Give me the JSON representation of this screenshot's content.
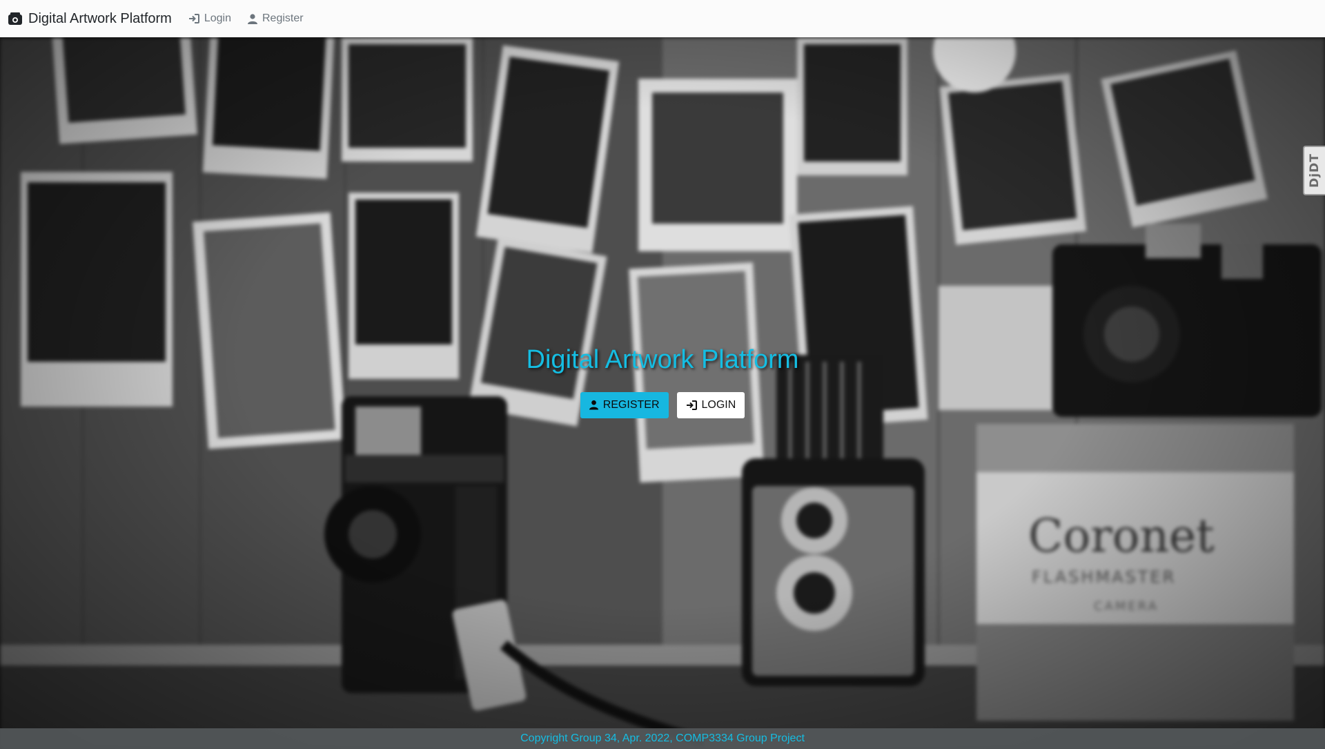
{
  "navbar": {
    "brand": "Digital Artwork Platform",
    "brand_icon": "camera-icon",
    "links": [
      {
        "label": "Login",
        "icon": "sign-in-icon"
      },
      {
        "label": "Register",
        "icon": "user-icon"
      }
    ]
  },
  "hero": {
    "title": "Digital Artwork Platform",
    "background": "black-and-white photo of vintage cameras in front of a wall of hanging photographs",
    "buttons": [
      {
        "label": "REGISTER",
        "icon": "user-icon"
      },
      {
        "label": "LOGIN",
        "icon": "sign-in-icon"
      }
    ]
  },
  "debug_toolbar": {
    "label": "DjDT"
  },
  "footer": {
    "text": "Copyright Group 34, Apr. 2022, COMP3334 Group Project"
  },
  "colors": {
    "accent": "#15bde2",
    "navbar_bg": "#fbfbfb",
    "footer_bg": "#555a5c"
  }
}
